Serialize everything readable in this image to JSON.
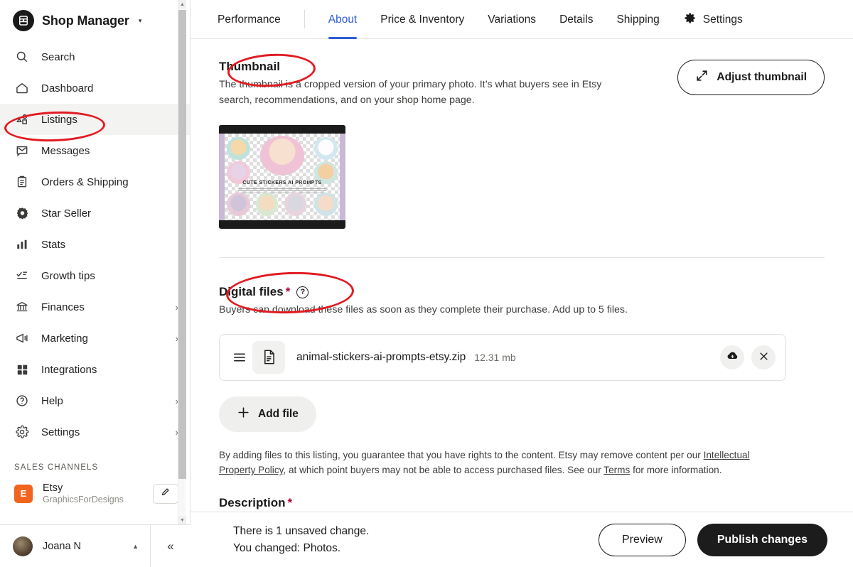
{
  "sidebar": {
    "brand": {
      "name": "Shop Manager",
      "caret": "▾",
      "logo_icon": "etsy-shop-logo"
    },
    "items": [
      {
        "label": "Search",
        "icon": "search-icon",
        "chevron": "",
        "active": false
      },
      {
        "label": "Dashboard",
        "icon": "home-icon",
        "chevron": "",
        "active": false
      },
      {
        "label": "Listings",
        "icon": "listings-icon",
        "chevron": "",
        "active": true
      },
      {
        "label": "Messages",
        "icon": "envelope-icon",
        "chevron": "",
        "active": false
      },
      {
        "label": "Orders & Shipping",
        "icon": "clipboard-icon",
        "chevron": "",
        "active": false
      },
      {
        "label": "Star Seller",
        "icon": "star-seller-icon",
        "chevron": "",
        "active": false
      },
      {
        "label": "Stats",
        "icon": "bar-chart-icon",
        "chevron": "",
        "active": false
      },
      {
        "label": "Growth tips",
        "icon": "growth-tips-icon",
        "chevron": "",
        "active": false
      },
      {
        "label": "Finances",
        "icon": "bank-icon",
        "chevron": "›",
        "active": false
      },
      {
        "label": "Marketing",
        "icon": "megaphone-icon",
        "chevron": "›",
        "active": false
      },
      {
        "label": "Integrations",
        "icon": "grid-icon",
        "chevron": "",
        "active": false
      },
      {
        "label": "Help",
        "icon": "question-circle-icon",
        "chevron": "›",
        "active": false
      },
      {
        "label": "Settings",
        "icon": "gear-icon",
        "chevron": "›",
        "active": false
      }
    ],
    "sales_channels_title": "SALES CHANNELS",
    "channel": {
      "badge": "E",
      "name": "Etsy",
      "shop": "GraphicsForDesigns",
      "edit_icon": "pencil-icon"
    },
    "footer": {
      "user_name": "Joana N",
      "caret": "▲",
      "collapse_icon": "chevron-double-left-icon"
    }
  },
  "tabs": [
    {
      "label": "Performance",
      "active": false,
      "icon": ""
    },
    {
      "label": "About",
      "active": true,
      "icon": ""
    },
    {
      "label": "Price & Inventory",
      "active": false,
      "icon": ""
    },
    {
      "label": "Variations",
      "active": false,
      "icon": ""
    },
    {
      "label": "Details",
      "active": false,
      "icon": ""
    },
    {
      "label": "Shipping",
      "active": false,
      "icon": ""
    },
    {
      "label": "Settings",
      "active": false,
      "icon": "gear-icon"
    }
  ],
  "thumbnail": {
    "title": "Thumbnail",
    "description": "The thumbnail is a cropped version of your primary photo. It’s what buyers see in Etsy search, recommendations, and on your shop home page.",
    "adjust_button": "Adjust thumbnail",
    "adjust_icon": "expand-arrows-icon",
    "image_caption": "CUTE STICKERS AI PROMPTS",
    "image_alt": "sticker-sheet-preview"
  },
  "digital_files": {
    "title": "Digital files",
    "required_mark": "*",
    "help_icon": "question-mark-icon",
    "description": "Buyers can download these files as soon as they complete their purchase. Add up to 5 files.",
    "file": {
      "name": "animal-stickers-ai-prompts-etsy.zip",
      "size": "12.31 mb",
      "drag_icon": "drag-handle-icon",
      "type_icon": "document-icon",
      "download_icon": "cloud-download-icon",
      "remove_icon": "close-icon"
    },
    "add_file_button": "Add file",
    "add_file_icon": "plus-icon",
    "legal_pre": "By adding files to this listing, you guarantee that you have rights to the content. Etsy may remove content per our ",
    "legal_link1": "Intellectual Property Policy",
    "legal_mid": ", at which point buyers may not be able to access purchased files. See our ",
    "legal_link2": "Terms",
    "legal_post": " for more information."
  },
  "description_section": {
    "title": "Description",
    "required_mark": "*"
  },
  "bottom_bar": {
    "line1": "There is 1 unsaved change.",
    "line2": "You changed: Photos.",
    "preview_button": "Preview",
    "publish_button": "Publish changes"
  },
  "colors": {
    "accent_blue": "#2f5ed1",
    "annotation_red": "#e11b22",
    "etsy_orange": "#f1641e",
    "required_red": "#b3002d",
    "publish_black": "#1c1c1c"
  }
}
